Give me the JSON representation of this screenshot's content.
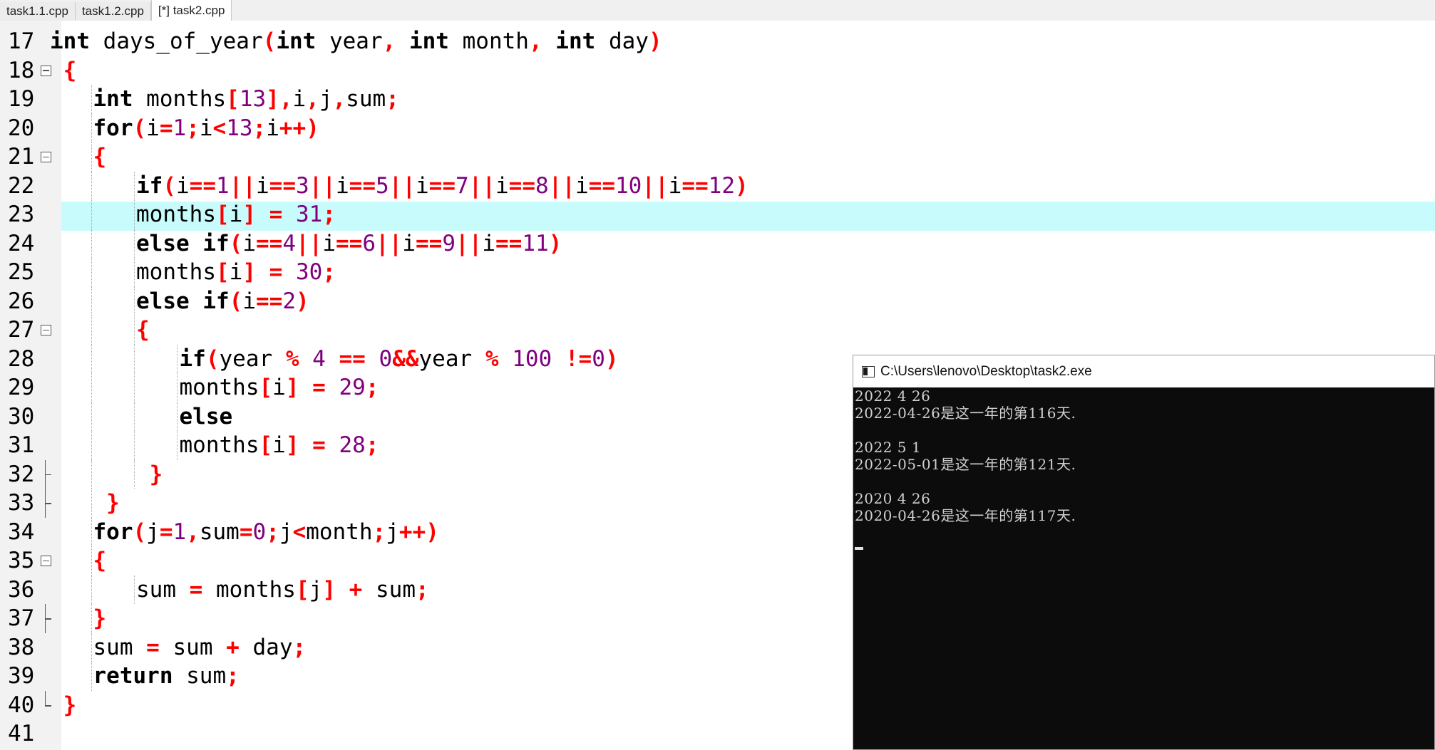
{
  "tabs": [
    {
      "label": "task1.1.cpp",
      "active": false
    },
    {
      "label": "task1.2.cpp",
      "active": false
    },
    {
      "label": "[*] task2.cpp",
      "active": true
    }
  ],
  "editor": {
    "highlight_line": 23,
    "lines": [
      {
        "num": "17",
        "fold": "",
        "indent": 0,
        "tokens": [
          [
            "k",
            "int"
          ],
          [
            "i",
            " days_of_year"
          ],
          [
            "p",
            "("
          ],
          [
            "k",
            "int"
          ],
          [
            "i",
            " year"
          ],
          [
            "p",
            ", "
          ],
          [
            "k",
            "int"
          ],
          [
            "i",
            " month"
          ],
          [
            "p",
            ", "
          ],
          [
            "k",
            "int"
          ],
          [
            "i",
            " day"
          ],
          [
            "p",
            ")"
          ]
        ]
      },
      {
        "num": "18",
        "fold": "box",
        "indent": 0,
        "tokens": [
          [
            "p",
            " {"
          ]
        ]
      },
      {
        "num": "19",
        "fold": "",
        "indent": 1,
        "tokens": [
          [
            "k",
            "int"
          ],
          [
            "i",
            " months"
          ],
          [
            "p",
            "["
          ],
          [
            "n",
            "13"
          ],
          [
            "p",
            "]"
          ],
          [
            "p",
            ","
          ],
          [
            "i",
            "i"
          ],
          [
            "p",
            ","
          ],
          [
            "i",
            "j"
          ],
          [
            "p",
            ","
          ],
          [
            "i",
            "sum"
          ],
          [
            "p",
            ";"
          ]
        ]
      },
      {
        "num": "20",
        "fold": "",
        "indent": 1,
        "tokens": [
          [
            "k",
            "for"
          ],
          [
            "p",
            "("
          ],
          [
            "i",
            "i"
          ],
          [
            "p",
            "="
          ],
          [
            "n",
            "1"
          ],
          [
            "p",
            ";"
          ],
          [
            "i",
            "i"
          ],
          [
            "p",
            "<"
          ],
          [
            "n",
            "13"
          ],
          [
            "p",
            ";"
          ],
          [
            "i",
            "i"
          ],
          [
            "p",
            "++)"
          ]
        ]
      },
      {
        "num": "21",
        "fold": "box",
        "indent": 1,
        "tokens": [
          [
            "p",
            "{"
          ]
        ]
      },
      {
        "num": "22",
        "fold": "",
        "indent": 2,
        "tokens": [
          [
            "k",
            "if"
          ],
          [
            "p",
            "("
          ],
          [
            "i",
            "i"
          ],
          [
            "p",
            "=="
          ],
          [
            "n",
            "1"
          ],
          [
            "p",
            "||"
          ],
          [
            "i",
            "i"
          ],
          [
            "p",
            "=="
          ],
          [
            "n",
            "3"
          ],
          [
            "p",
            "||"
          ],
          [
            "i",
            "i"
          ],
          [
            "p",
            "=="
          ],
          [
            "n",
            "5"
          ],
          [
            "p",
            "||"
          ],
          [
            "i",
            "i"
          ],
          [
            "p",
            "=="
          ],
          [
            "n",
            "7"
          ],
          [
            "p",
            "||"
          ],
          [
            "i",
            "i"
          ],
          [
            "p",
            "=="
          ],
          [
            "n",
            "8"
          ],
          [
            "p",
            "||"
          ],
          [
            "i",
            "i"
          ],
          [
            "p",
            "=="
          ],
          [
            "n",
            "10"
          ],
          [
            "p",
            "||"
          ],
          [
            "i",
            "i"
          ],
          [
            "p",
            "=="
          ],
          [
            "n",
            "12"
          ],
          [
            "p",
            ")"
          ]
        ]
      },
      {
        "num": "23",
        "fold": "",
        "indent": 2,
        "tokens": [
          [
            "i",
            "months"
          ],
          [
            "p",
            "["
          ],
          [
            "i",
            "i"
          ],
          [
            "p",
            "]"
          ],
          [
            "i",
            " "
          ],
          [
            "p",
            "="
          ],
          [
            "i",
            " "
          ],
          [
            "n",
            "31"
          ],
          [
            "p",
            ";"
          ]
        ]
      },
      {
        "num": "24",
        "fold": "",
        "indent": 2,
        "tokens": [
          [
            "k",
            "else if"
          ],
          [
            "p",
            "("
          ],
          [
            "i",
            "i"
          ],
          [
            "p",
            "=="
          ],
          [
            "n",
            "4"
          ],
          [
            "p",
            "||"
          ],
          [
            "i",
            "i"
          ],
          [
            "p",
            "=="
          ],
          [
            "n",
            "6"
          ],
          [
            "p",
            "||"
          ],
          [
            "i",
            "i"
          ],
          [
            "p",
            "=="
          ],
          [
            "n",
            "9"
          ],
          [
            "p",
            "||"
          ],
          [
            "i",
            "i"
          ],
          [
            "p",
            "=="
          ],
          [
            "n",
            "11"
          ],
          [
            "p",
            ")"
          ]
        ]
      },
      {
        "num": "25",
        "fold": "",
        "indent": 2,
        "tokens": [
          [
            "i",
            "months"
          ],
          [
            "p",
            "["
          ],
          [
            "i",
            "i"
          ],
          [
            "p",
            "]"
          ],
          [
            "i",
            " "
          ],
          [
            "p",
            "="
          ],
          [
            "i",
            " "
          ],
          [
            "n",
            "30"
          ],
          [
            "p",
            ";"
          ]
        ]
      },
      {
        "num": "26",
        "fold": "",
        "indent": 2,
        "tokens": [
          [
            "k",
            "else if"
          ],
          [
            "p",
            "("
          ],
          [
            "i",
            "i"
          ],
          [
            "p",
            "=="
          ],
          [
            "n",
            "2"
          ],
          [
            "p",
            ")"
          ]
        ]
      },
      {
        "num": "27",
        "fold": "box",
        "indent": 2,
        "tokens": [
          [
            "p",
            "{"
          ]
        ]
      },
      {
        "num": "28",
        "fold": "",
        "indent": 3,
        "tokens": [
          [
            "k",
            "if"
          ],
          [
            "p",
            "("
          ],
          [
            "i",
            "year "
          ],
          [
            "p",
            "%"
          ],
          [
            "i",
            " "
          ],
          [
            "n",
            "4"
          ],
          [
            "i",
            " "
          ],
          [
            "p",
            "=="
          ],
          [
            "i",
            " "
          ],
          [
            "n",
            "0"
          ],
          [
            "p",
            "&&"
          ],
          [
            "i",
            "year "
          ],
          [
            "p",
            "%"
          ],
          [
            "i",
            " "
          ],
          [
            "n",
            "100"
          ],
          [
            "i",
            " "
          ],
          [
            "p",
            "!="
          ],
          [
            "n",
            "0"
          ],
          [
            "p",
            ")"
          ]
        ]
      },
      {
        "num": "29",
        "fold": "",
        "indent": 3,
        "tokens": [
          [
            "i",
            "months"
          ],
          [
            "p",
            "["
          ],
          [
            "i",
            "i"
          ],
          [
            "p",
            "]"
          ],
          [
            "i",
            " "
          ],
          [
            "p",
            "="
          ],
          [
            "i",
            " "
          ],
          [
            "n",
            "29"
          ],
          [
            "p",
            ";"
          ]
        ]
      },
      {
        "num": "30",
        "fold": "",
        "indent": 3,
        "tokens": [
          [
            "k",
            "else"
          ]
        ]
      },
      {
        "num": "31",
        "fold": "",
        "indent": 3,
        "tokens": [
          [
            "i",
            "months"
          ],
          [
            "p",
            "["
          ],
          [
            "i",
            "i"
          ],
          [
            "p",
            "]"
          ],
          [
            "i",
            " "
          ],
          [
            "p",
            "="
          ],
          [
            "i",
            " "
          ],
          [
            "n",
            "28"
          ],
          [
            "p",
            ";"
          ]
        ]
      },
      {
        "num": "32",
        "fold": "tee",
        "indent": 2,
        "tokens": [
          [
            "p",
            " }"
          ]
        ]
      },
      {
        "num": "33",
        "fold": "tee",
        "indent": 1,
        "tokens": [
          [
            "p",
            " }"
          ]
        ]
      },
      {
        "num": "34",
        "fold": "",
        "indent": 1,
        "tokens": [
          [
            "k",
            "for"
          ],
          [
            "p",
            "("
          ],
          [
            "i",
            "j"
          ],
          [
            "p",
            "="
          ],
          [
            "n",
            "1"
          ],
          [
            "p",
            ","
          ],
          [
            "i",
            "sum"
          ],
          [
            "p",
            "="
          ],
          [
            "n",
            "0"
          ],
          [
            "p",
            ";"
          ],
          [
            "i",
            "j"
          ],
          [
            "p",
            "<"
          ],
          [
            "i",
            "month"
          ],
          [
            "p",
            ";"
          ],
          [
            "i",
            "j"
          ],
          [
            "p",
            "++)"
          ]
        ]
      },
      {
        "num": "35",
        "fold": "box",
        "indent": 1,
        "tokens": [
          [
            "p",
            "{"
          ]
        ]
      },
      {
        "num": "36",
        "fold": "",
        "indent": 2,
        "tokens": [
          [
            "i",
            "sum "
          ],
          [
            "p",
            "="
          ],
          [
            "i",
            " months"
          ],
          [
            "p",
            "["
          ],
          [
            "i",
            "j"
          ],
          [
            "p",
            "]"
          ],
          [
            "i",
            " "
          ],
          [
            "p",
            "+"
          ],
          [
            "i",
            " sum"
          ],
          [
            "p",
            ";"
          ]
        ]
      },
      {
        "num": "37",
        "fold": "tee",
        "indent": 1,
        "tokens": [
          [
            "p",
            "}"
          ]
        ]
      },
      {
        "num": "38",
        "fold": "",
        "indent": 1,
        "tokens": [
          [
            "i",
            "sum "
          ],
          [
            "p",
            "="
          ],
          [
            "i",
            " sum "
          ],
          [
            "p",
            "+"
          ],
          [
            "i",
            " day"
          ],
          [
            "p",
            ";"
          ]
        ]
      },
      {
        "num": "39",
        "fold": "",
        "indent": 1,
        "tokens": [
          [
            "k",
            "return"
          ],
          [
            "i",
            " sum"
          ],
          [
            "p",
            ";"
          ]
        ]
      },
      {
        "num": "40",
        "fold": "end",
        "indent": 0,
        "tokens": [
          [
            "p",
            " }"
          ]
        ]
      },
      {
        "num": "41",
        "fold": "",
        "indent": 0,
        "tokens": []
      }
    ]
  },
  "console": {
    "title": "C:\\Users\\lenovo\\Desktop\\task2.exe",
    "lines": [
      "2022 4 26",
      "2022-04-26是这一年的第116天.",
      "",
      "2022 5 1",
      "2022-05-01是这一年的第121天.",
      "",
      "2020 4 26",
      "2020-04-26是这一年的第117天.",
      ""
    ]
  },
  "colors": {
    "keyword": "#000000",
    "number": "#800080",
    "punctuation": "#ff0000",
    "current_line": "#c8fbfb",
    "console_bg": "#0c0c0c",
    "console_fg": "#cfcfcf"
  }
}
